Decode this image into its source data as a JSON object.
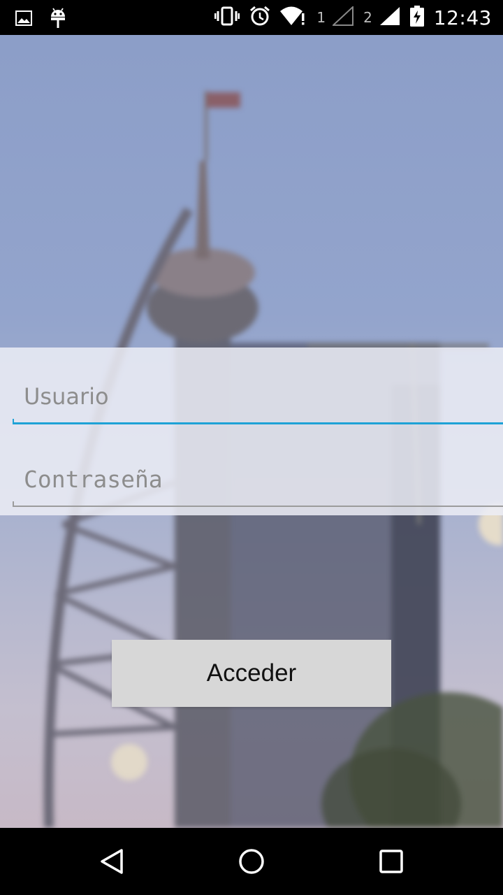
{
  "status_bar": {
    "time": "12:43",
    "sim1_label": "1",
    "sim2_label": "2",
    "icons_left": [
      "image-icon",
      "android-debug-icon"
    ],
    "icons_right": [
      "vibrate-icon",
      "alarm-icon",
      "wifi-alert-icon",
      "signal-sim1-icon",
      "signal-sim2-icon",
      "battery-charging-icon"
    ]
  },
  "login": {
    "username_placeholder": "Usuario",
    "password_placeholder": "Contraseña",
    "submit_label": "Acceder"
  },
  "colors": {
    "accent": "#1ea2d6",
    "button_bg": "#d7d7d7",
    "panel_bg": "#eceef6"
  },
  "nav_bar": {
    "icons": [
      "back-icon",
      "home-icon",
      "recents-icon"
    ]
  }
}
